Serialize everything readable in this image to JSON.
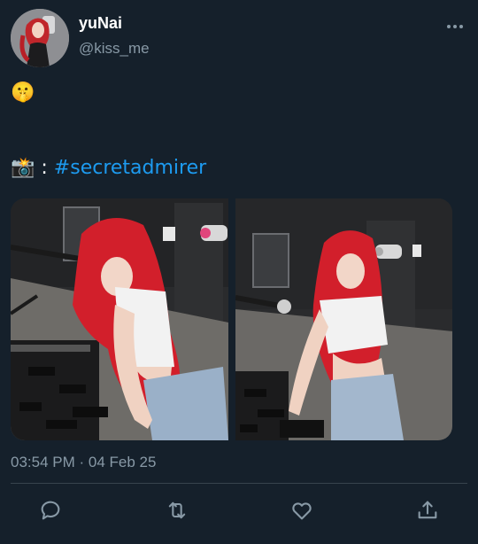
{
  "user": {
    "display_name": "yuNai",
    "handle": "@kiss_me"
  },
  "tweet": {
    "emoji_line": "🤫",
    "caption_prefix": "📸 : ",
    "hashtag": "#secretadmirer",
    "timestamp": "03:54 PM · 04 Feb 25"
  },
  "media": {
    "photos": [
      "photo-1",
      "photo-2"
    ]
  },
  "actions": [
    "reply-icon",
    "retweet-icon",
    "like-icon",
    "share-icon"
  ],
  "colors": {
    "background": "#15202b",
    "accent": "#1d9bf0",
    "muted": "#8899a6",
    "divider": "#38444d"
  }
}
